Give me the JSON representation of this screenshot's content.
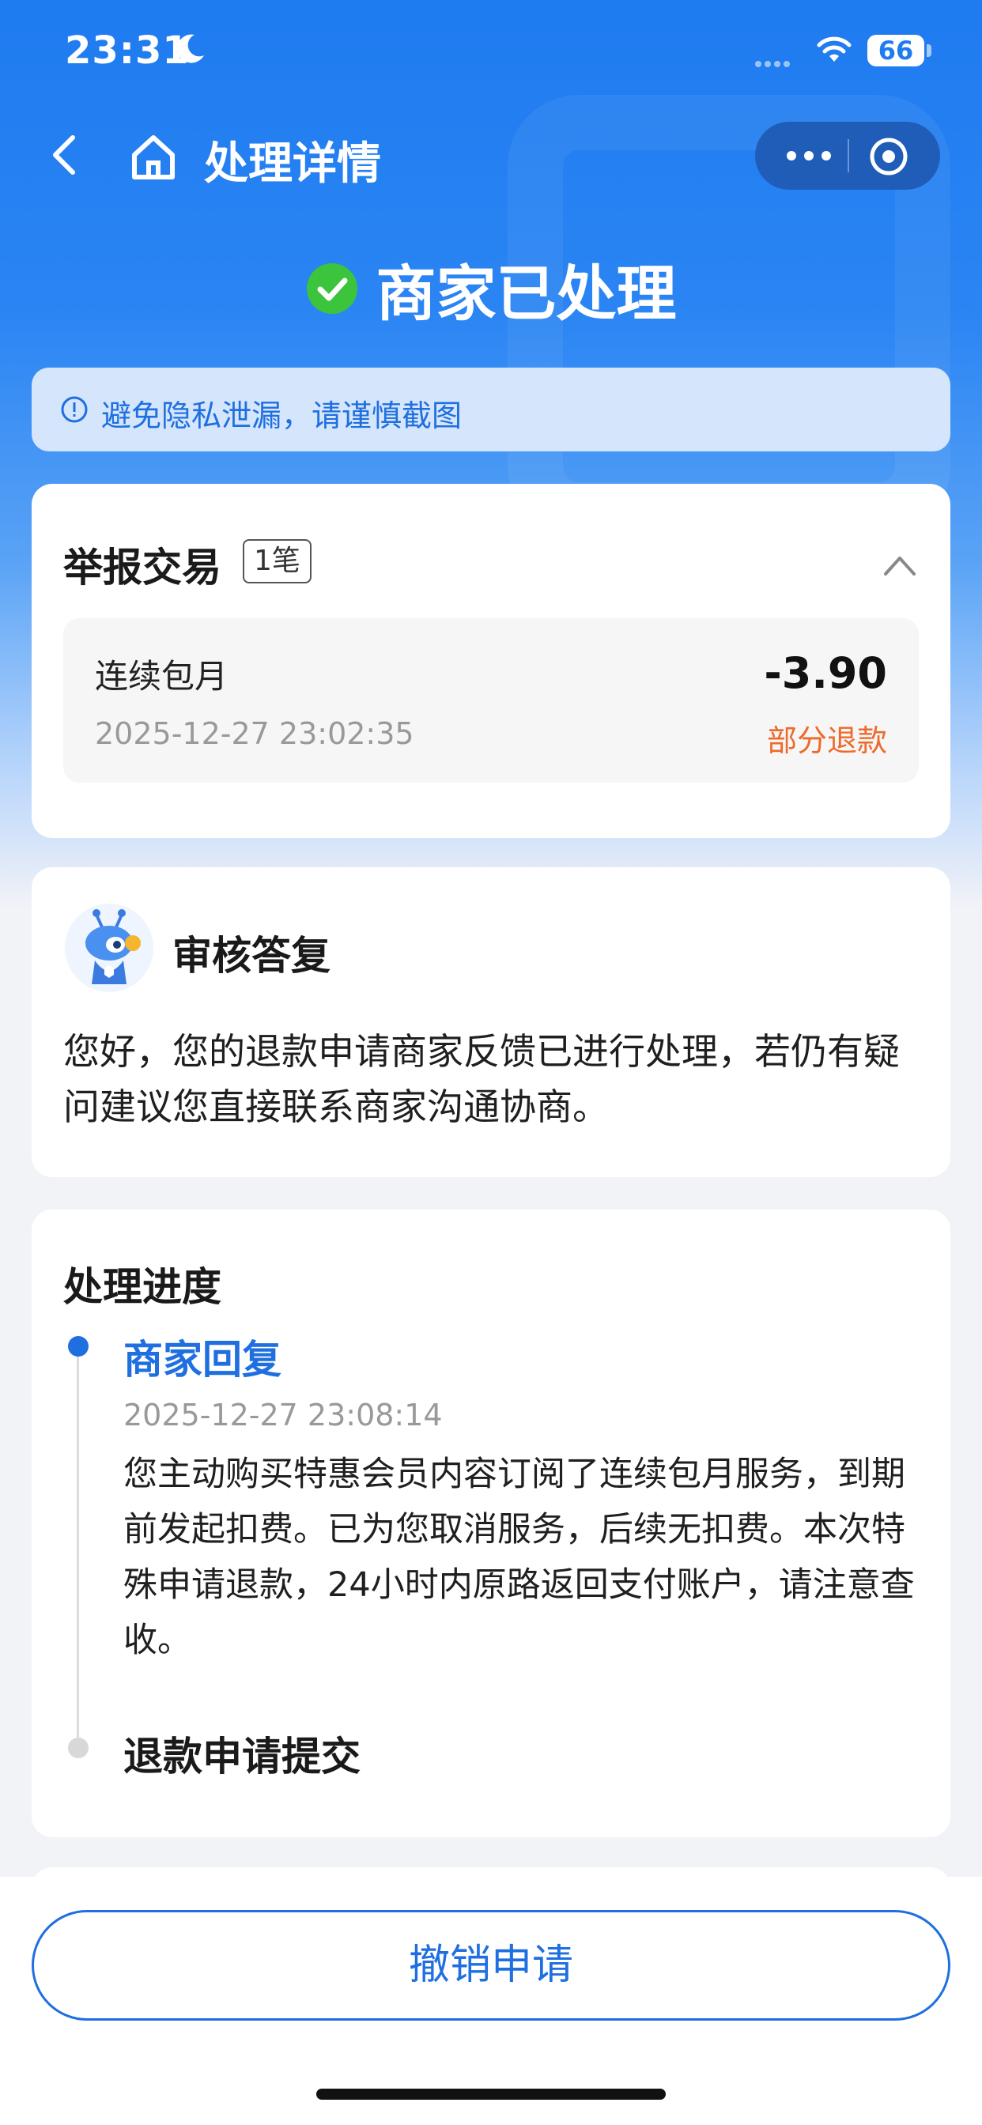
{
  "status_bar": {
    "time": "23:31",
    "battery": "66"
  },
  "nav": {
    "title": "处理详情"
  },
  "headline": {
    "status": "商家已处理"
  },
  "notice": {
    "text": "避免隐私泄漏，请谨慎截图"
  },
  "report": {
    "title": "举报交易",
    "count": "1笔",
    "transaction": {
      "name": "连续包月",
      "datetime": "2025-12-27 23:02:35",
      "amount": "-3.90",
      "status": "部分退款"
    }
  },
  "review": {
    "title": "审核答复",
    "body": "您好，您的退款申请商家反馈已进行处理，若仍有疑问建议您直接联系商家沟通协商。"
  },
  "progress": {
    "title": "处理进度",
    "steps": [
      {
        "title": "商家回复",
        "datetime": "2025-12-27 23:08:14",
        "body": "您主动购买特惠会员内容订阅了连续包月服务，到期前发起扣费。已为您取消服务，后续无扣费。本次特殊申请退款，24小时内原路返回支付账户，请注意查收。"
      },
      {
        "title": "退款申请提交"
      }
    ]
  },
  "footer": {
    "cancel_label": "撤销申请"
  },
  "colors": {
    "primary": "#1f6fe0",
    "header_blue": "#1e7bf0",
    "success_green": "#3cc43c",
    "refund_orange": "#ee6a2a"
  }
}
